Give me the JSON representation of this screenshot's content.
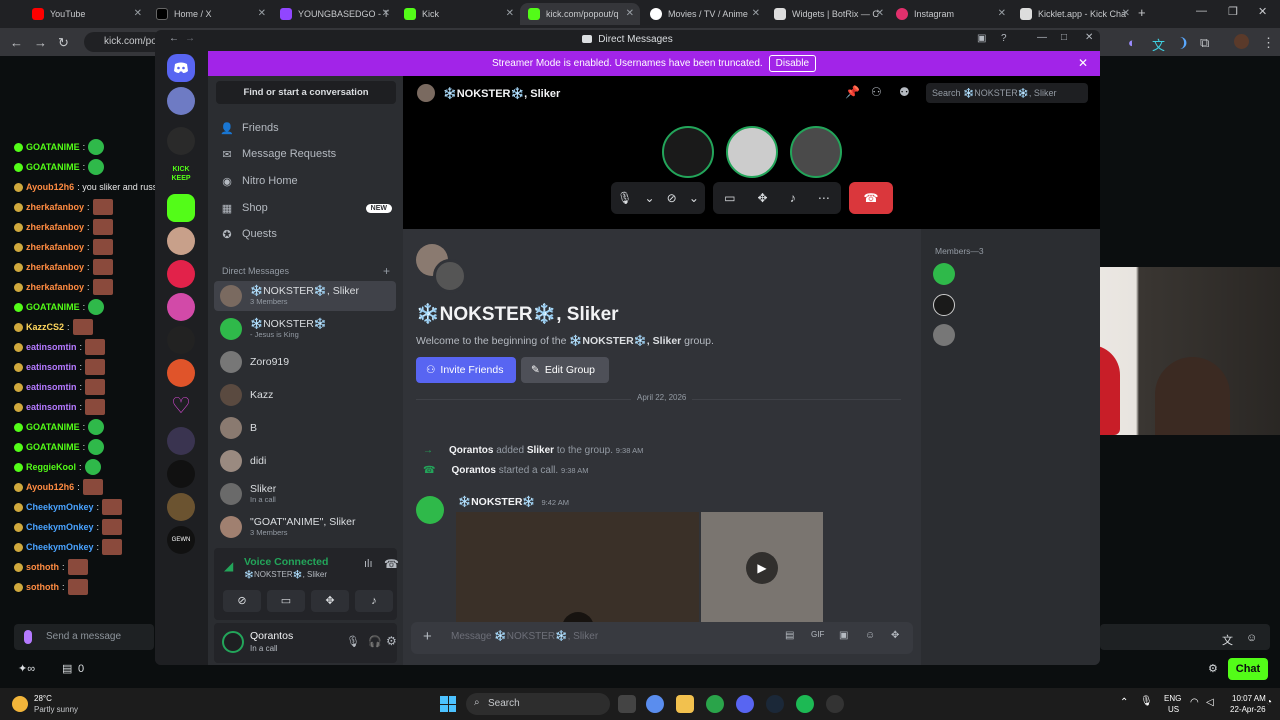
{
  "browser": {
    "tabs": [
      "YouTube",
      "Home / X",
      "YOUNGBASEDGO - T",
      "Kick",
      "kick.com/popout/q",
      "Movies / TV / Anime",
      "Widgets | BotRix — C",
      "Instagram",
      "Kicklet.app - Kick Cha"
    ],
    "address": "kick.com/po"
  },
  "kick_chat": {
    "lines": [
      {
        "user": "GOATANIME",
        "text": ":",
        "color": "#53fc18"
      },
      {
        "user": "GOATANIME",
        "text": ":",
        "color": "#53fc18"
      },
      {
        "user": "Ayoub12h6",
        "text": ": you sliker and russ",
        "color": "#ff8c42"
      },
      {
        "user": "zherkafanboy",
        "text": ":",
        "color": "#ff8c42"
      },
      {
        "user": "zherkafanboy",
        "text": ":",
        "color": "#ff8c42"
      },
      {
        "user": "zherkafanboy",
        "text": ":",
        "color": "#ff8c42"
      },
      {
        "user": "zherkafanboy",
        "text": ":",
        "color": "#ff8c42"
      },
      {
        "user": "zherkafanboy",
        "text": ":",
        "color": "#ff8c42"
      },
      {
        "user": "GOATANIME",
        "text": ":",
        "color": "#53fc18"
      },
      {
        "user": "KazzCS2",
        "text": ":",
        "color": "#ffd75e"
      },
      {
        "user": "eatinsomtin",
        "text": ":",
        "color": "#b57aff"
      },
      {
        "user": "eatinsomtin",
        "text": ":",
        "color": "#b57aff"
      },
      {
        "user": "eatinsomtin",
        "text": ":",
        "color": "#b57aff"
      },
      {
        "user": "eatinsomtin",
        "text": ":",
        "color": "#b57aff"
      },
      {
        "user": "GOATANIME",
        "text": ":",
        "color": "#53fc18"
      },
      {
        "user": "GOATANIME",
        "text": ":",
        "color": "#53fc18"
      },
      {
        "user": "ReggieKool",
        "text": ":",
        "color": "#53fc18"
      },
      {
        "user": "Ayoub12h6",
        "text": ":",
        "color": "#ff8c42"
      },
      {
        "user": "CheekymOnkey",
        "text": ":",
        "color": "#4aa3ff"
      },
      {
        "user": "CheekymOnkey",
        "text": ":",
        "color": "#4aa3ff"
      },
      {
        "user": "CheekymOnkey",
        "text": ":",
        "color": "#4aa3ff"
      },
      {
        "user": "sothoth",
        "text": ":",
        "color": "#ff8c42"
      },
      {
        "user": "sothoth",
        "text": ":",
        "color": "#ff8c42"
      }
    ],
    "send_placeholder": "Send a message",
    "count": "0",
    "chat_button": "Chat"
  },
  "discord": {
    "window_title": "Direct Messages",
    "banner_text": "Streamer Mode is enabled. Usernames have been truncated.",
    "banner_button": "Disable",
    "find_conversation": "Find or start a conversation",
    "nav": [
      "Friends",
      "Message Requests",
      "Nitro Home",
      "Shop",
      "Quests"
    ],
    "shop_badge": "NEW",
    "dm_header": "Direct Messages",
    "dms": [
      {
        "name": "❄️NOKSTER❄️, Sliker",
        "sub": "3 Members"
      },
      {
        "name": "❄️NOKSTER❄️",
        "sub": "- Jesus is King"
      },
      {
        "name": "Zoro919",
        "sub": ""
      },
      {
        "name": "Kazz",
        "sub": ""
      },
      {
        "name": "B",
        "sub": ""
      },
      {
        "name": "didi",
        "sub": ""
      },
      {
        "name": "Sliker",
        "sub": "In a call"
      },
      {
        "name": "\"GOAT\"ANIME\", Sliker",
        "sub": "3 Members"
      }
    ],
    "voice_status": "Voice Connected",
    "voice_channel": "❄️NOKSTER❄️, Sliker",
    "user_name": "Qorantos",
    "user_status": "In a call",
    "call_title": "❄️NOKSTER❄️, Sliker",
    "search_placeholder": "Search ❄️NOKSTER❄️, Sliker",
    "chat_title": "❄️NOKSTER❄️, Sliker",
    "welcome_prefix": "Welcome to the beginning of the ",
    "welcome_group": "❄️NOKSTER❄️, Sliker",
    "welcome_suffix": " group.",
    "invite_button": "Invite Friends",
    "edit_button": "Edit Group",
    "date_divider": "April 22, 2026",
    "sys1": {
      "actor": "Qorantos",
      "mid": " added ",
      "target": "Sliker",
      "end": " to the group.",
      "time": "9:38 AM"
    },
    "sys2": {
      "actor": "Qorantos",
      "mid": " started a call.",
      "time": "9:38 AM"
    },
    "msg_author": "❄️NOKSTER❄️",
    "msg_time": "9:42 AM",
    "composer_placeholder": "Message ❄️NOKSTER❄️, Sliker",
    "members_header": "Members—3"
  },
  "taskbar": {
    "weather_temp": "28°C",
    "weather_desc": "Partly sunny",
    "search": "Search",
    "lang1": "ENG",
    "lang2": "US",
    "time": "10:07 AM",
    "date": "22-Apr-26"
  }
}
